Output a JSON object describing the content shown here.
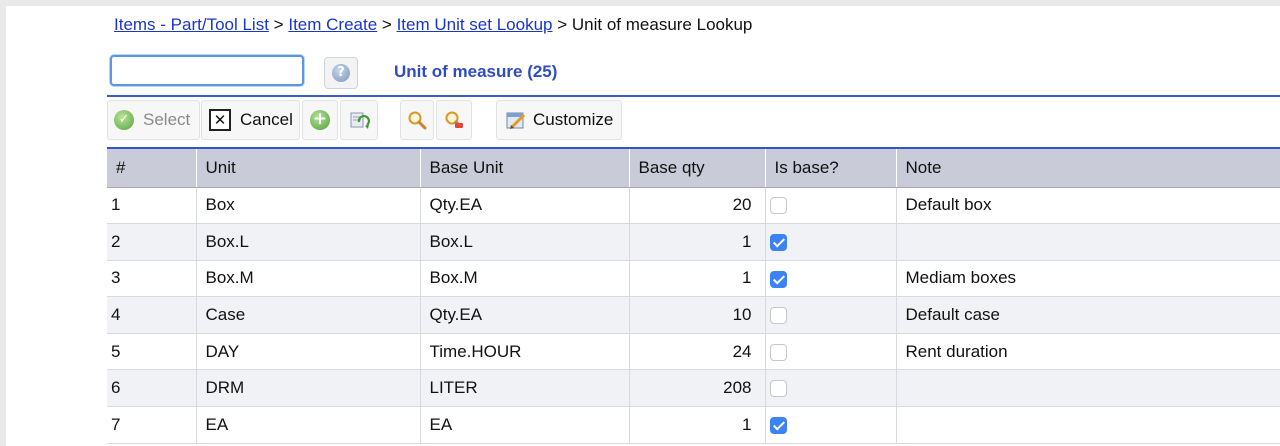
{
  "breadcrumb": {
    "links": [
      "Items - Part/Tool List",
      "Item Create",
      "Item Unit set Lookup"
    ],
    "separator": ">",
    "current": "Unit of measure Lookup"
  },
  "search": {
    "value": "",
    "placeholder": ""
  },
  "lookup_title": "Unit of measure (25)",
  "toolbar": {
    "select_label": "Select",
    "cancel_label": "Cancel",
    "customize_label": "Customize"
  },
  "table": {
    "columns": [
      "#",
      "Unit",
      "Base Unit",
      "Base qty",
      "Is base?",
      "Note"
    ],
    "rows": [
      {
        "num": "1",
        "unit": "Box",
        "base_unit": "Qty.EA",
        "base_qty": "20",
        "is_base": false,
        "note": "Default box"
      },
      {
        "num": "2",
        "unit": "Box.L",
        "base_unit": "Box.L",
        "base_qty": "1",
        "is_base": true,
        "note": ""
      },
      {
        "num": "3",
        "unit": "Box.M",
        "base_unit": "Box.M",
        "base_qty": "1",
        "is_base": true,
        "note": "Mediam boxes"
      },
      {
        "num": "4",
        "unit": "Case",
        "base_unit": "Qty.EA",
        "base_qty": "10",
        "is_base": false,
        "note": "Default case"
      },
      {
        "num": "5",
        "unit": "DAY",
        "base_unit": "Time.HOUR",
        "base_qty": "24",
        "is_base": false,
        "note": "Rent duration"
      },
      {
        "num": "6",
        "unit": "DRM",
        "base_unit": "LITER",
        "base_qty": "208",
        "is_base": false,
        "note": ""
      },
      {
        "num": "7",
        "unit": "EA",
        "base_unit": "EA",
        "base_qty": "1",
        "is_base": true,
        "note": ""
      }
    ]
  },
  "colors": {
    "link": "#1a36c9",
    "title": "#2f4dc0",
    "header_bg": "#c9cbd9",
    "rule": "#3a5cc7",
    "checkbox_on": "#3b82f6"
  },
  "icons": {
    "select": "check-circle-icon",
    "cancel": "x-box-icon",
    "add": "plus-circle-icon",
    "refresh": "refresh-icon",
    "find": "magnifier-icon",
    "clear_find": "magnifier-clear-icon",
    "customize": "customize-icon",
    "search_help": "help-icon"
  }
}
